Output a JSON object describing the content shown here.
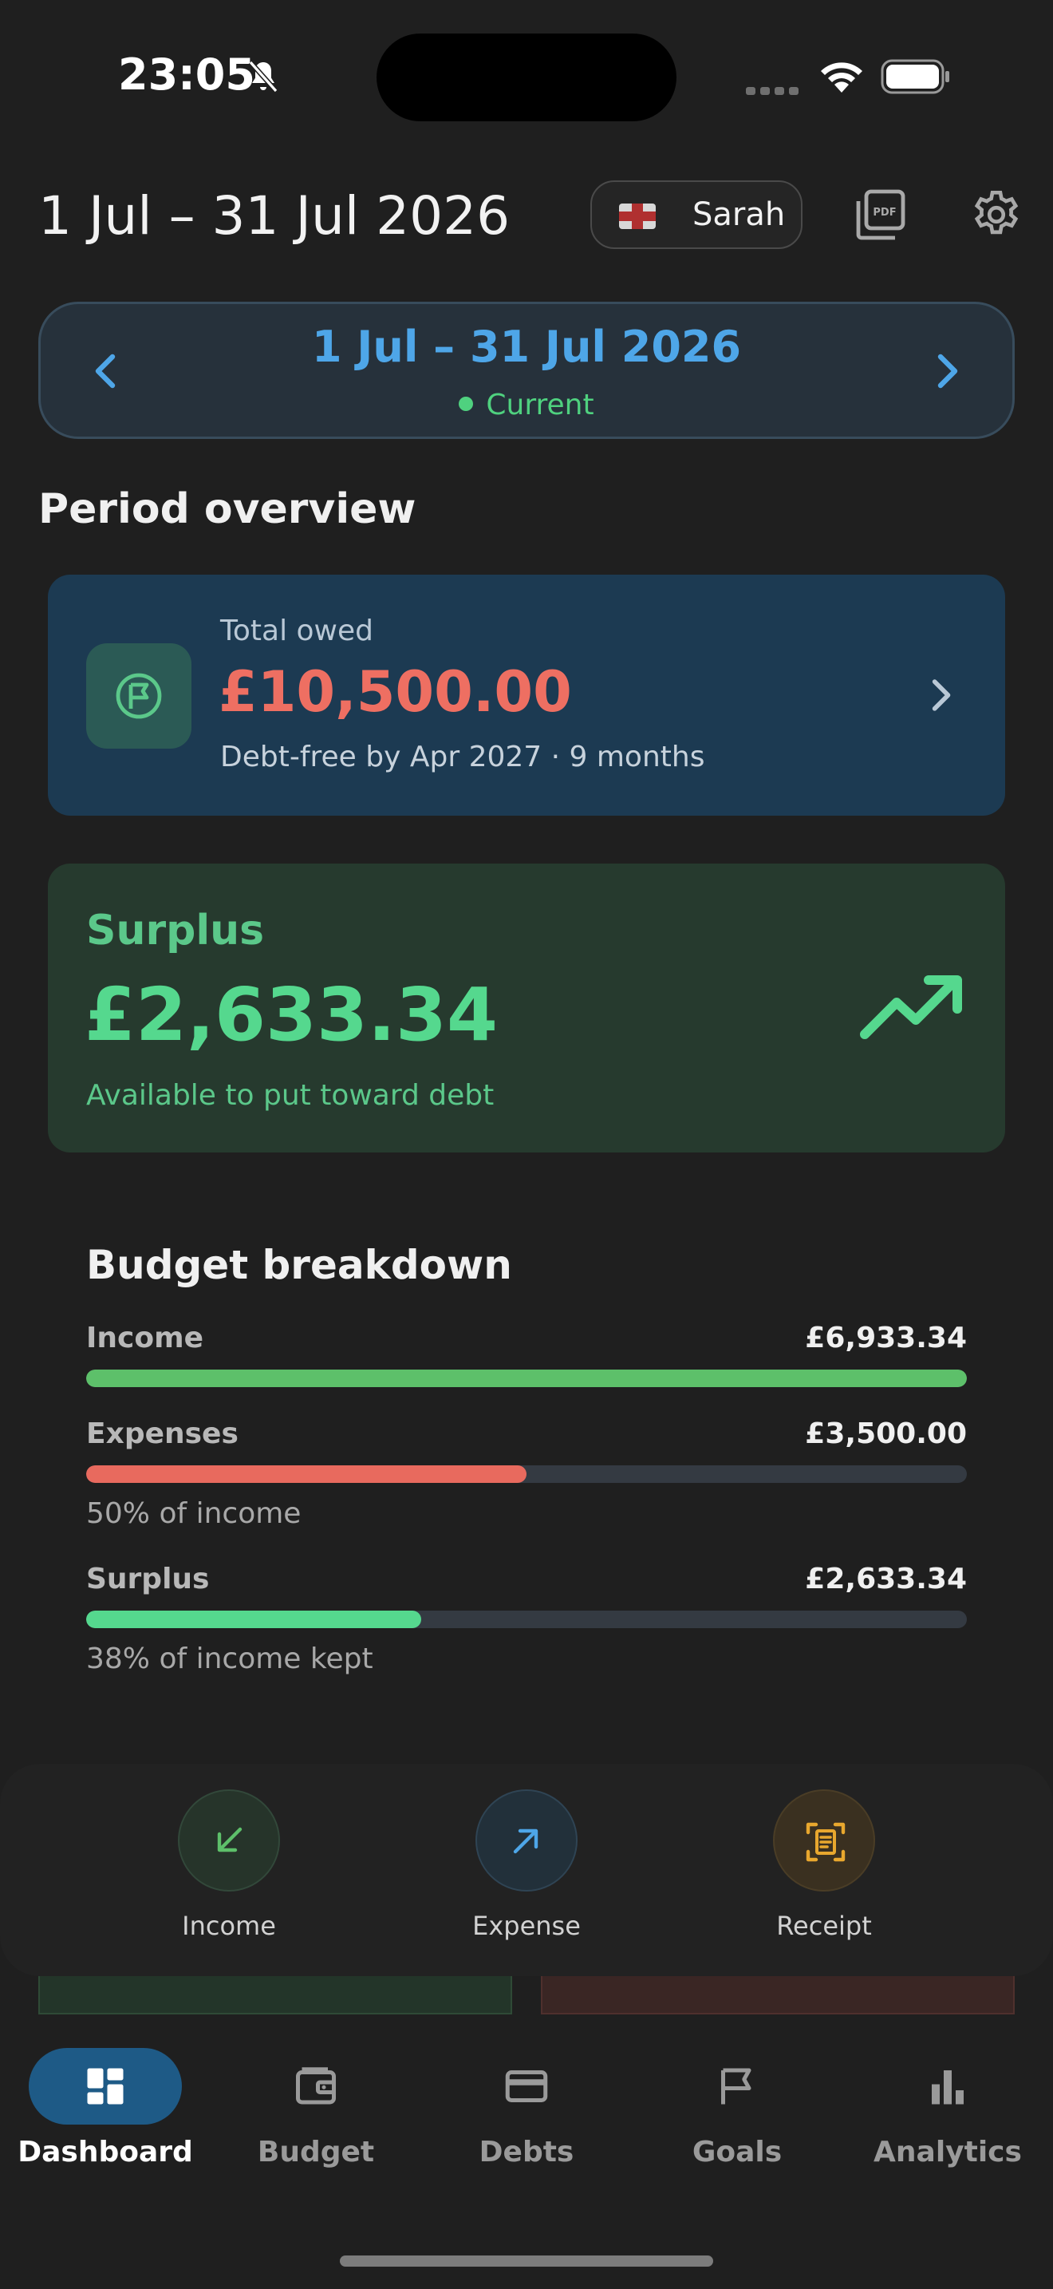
{
  "status_bar": {
    "time": "23:05"
  },
  "header": {
    "title": "1 Jul – 31 Jul 2026",
    "profile_name": "Sarah"
  },
  "period_selector": {
    "range": "1 Jul – 31 Jul 2026",
    "status": "Current"
  },
  "section_title": "Period overview",
  "debt_card": {
    "label": "Total owed",
    "amount": "£10,500.00",
    "subtitle": "Debt-free by Apr 2027 · 9 months"
  },
  "surplus_card": {
    "label": "Surplus",
    "amount": "£2,633.34",
    "subtitle": "Available to put toward debt"
  },
  "budget_breakdown": {
    "title": "Budget breakdown",
    "rows": [
      {
        "label": "Income",
        "value": "£6,933.34",
        "fraction": 1.0,
        "color": "#5dc06a",
        "note": ""
      },
      {
        "label": "Expenses",
        "value": "£3,500.00",
        "fraction": 0.5,
        "color": "#e86a5e",
        "note": "50% of income"
      },
      {
        "label": "Surplus",
        "value": "£2,633.34",
        "fraction": 0.38,
        "color": "#55d88e",
        "note": "38% of income kept"
      }
    ]
  },
  "quick_actions": [
    {
      "label": "Income",
      "icon": "arrow-down-left-icon"
    },
    {
      "label": "Expense",
      "icon": "arrow-up-right-icon"
    },
    {
      "label": "Receipt",
      "icon": "receipt-scan-icon"
    }
  ],
  "tabs": [
    {
      "label": "Dashboard",
      "icon": "dashboard-icon",
      "active": true
    },
    {
      "label": "Budget",
      "icon": "wallet-icon",
      "active": false
    },
    {
      "label": "Debts",
      "icon": "credit-card-icon",
      "active": false
    },
    {
      "label": "Goals",
      "icon": "flag-icon",
      "active": false
    },
    {
      "label": "Analytics",
      "icon": "bar-chart-icon",
      "active": false
    }
  ],
  "colors": {
    "background": "#1f1f1f",
    "accent_blue": "#4ea6e8",
    "debt_red": "#ee6f62",
    "surplus_green": "#55d88e",
    "active_tab": "#1e5a86"
  }
}
